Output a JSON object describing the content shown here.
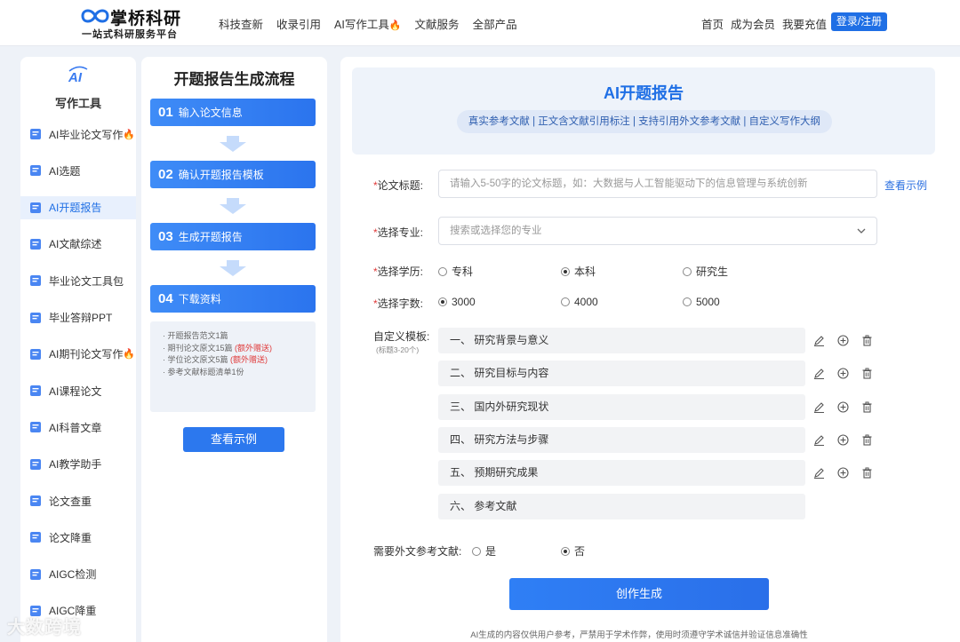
{
  "header": {
    "logo_title": "掌桥科研",
    "logo_subtitle": "一站式科研服务平台",
    "nav": [
      "科技查新",
      "收录引用",
      "AI写作工具",
      "文献服务",
      "全部产品"
    ],
    "right_nav": [
      "首页",
      "成为会员",
      "我要充值"
    ],
    "login_label": "登录/注册"
  },
  "sidebar": {
    "badge": "AI",
    "title": "写作工具",
    "items": [
      {
        "label": "AI毕业论文写作",
        "hot": true,
        "icon": "thesis-icon"
      },
      {
        "label": "AI选题",
        "hot": false,
        "icon": "topic-icon"
      },
      {
        "label": "AI开题报告",
        "hot": false,
        "icon": "report-icon",
        "active": true
      },
      {
        "label": "AI文献综述",
        "hot": false,
        "icon": "review-icon"
      },
      {
        "label": "毕业论文工具包",
        "hot": false,
        "icon": "toolkit-icon"
      },
      {
        "label": "毕业答辩PPT",
        "hot": false,
        "icon": "ppt-icon"
      },
      {
        "label": "AI期刊论文写作",
        "hot": true,
        "icon": "journal-icon"
      },
      {
        "label": "AI课程论文",
        "hot": false,
        "icon": "course-icon"
      },
      {
        "label": "AI科普文章",
        "hot": false,
        "icon": "popsci-icon"
      },
      {
        "label": "AI教学助手",
        "hot": false,
        "icon": "teaching-icon"
      },
      {
        "label": "论文查重",
        "hot": false,
        "icon": "check-icon"
      },
      {
        "label": "论文降重",
        "hot": false,
        "icon": "reduce-icon"
      },
      {
        "label": "AIGC检测",
        "hot": false,
        "icon": "aigc-detect-icon"
      },
      {
        "label": "AIGC降重",
        "hot": false,
        "icon": "aigc-reduce-icon"
      }
    ]
  },
  "process": {
    "title": "开题报告生成流程",
    "steps": [
      {
        "num": "01",
        "label": "输入论文信息"
      },
      {
        "num": "02",
        "label": "确认开题报告模板"
      },
      {
        "num": "03",
        "label": "生成开题报告"
      },
      {
        "num": "04",
        "label": "下载资料"
      }
    ],
    "downloads": [
      {
        "text": "· 开题报告范文1篇",
        "extra": ""
      },
      {
        "text": "· 期刊论文原文15篇",
        "extra": "(额外赠送)"
      },
      {
        "text": "· 学位论文原文5篇",
        "extra": "(额外赠送)"
      },
      {
        "text": "· 参考文献标题清单1份",
        "extra": ""
      }
    ],
    "sample_button": "查看示例"
  },
  "main": {
    "banner_title": "AI开题报告",
    "banner_tags": "真实参考文献 | 正文含文献引用标注 | 支持引用外文参考文献 | 自定义写作大纲",
    "title_label": "论文标题:",
    "title_placeholder": "请输入5-50字的论文标题，如：大数据与人工智能驱动下的信息管理与系统创新",
    "view_example": "查看示例",
    "major_label": "选择专业:",
    "major_placeholder": "搜索或选择您的专业",
    "degree_label": "选择学历:",
    "degree_options": [
      {
        "label": "专科",
        "selected": false
      },
      {
        "label": "本科",
        "selected": true
      },
      {
        "label": "研究生",
        "selected": false
      }
    ],
    "words_label": "选择字数:",
    "words_options": [
      {
        "label": "3000",
        "selected": true
      },
      {
        "label": "4000",
        "selected": false
      },
      {
        "label": "5000",
        "selected": false
      }
    ],
    "template_label": "自定义模板:",
    "template_sub": "(标题3-20个)",
    "template_rows": [
      "一、 研究背景与意义",
      "二、 研究目标与内容",
      "三、 国内外研究现状",
      "四、 研究方法与步骤",
      "五、 预期研究成果",
      "六、 参考文献"
    ],
    "foreign_label": "需要外文参考文献:",
    "foreign_options": [
      {
        "label": "是",
        "selected": false
      },
      {
        "label": "否",
        "selected": true
      }
    ],
    "generate_button": "创作生成",
    "footnote": "AI生成的内容仅供用户参考，严禁用于学术作弊，使用时须遵守学术诚信并验证信息准确性"
  },
  "watermark": "大数跨境",
  "colors": {
    "accent": "#1f6fe5",
    "hot": "#ff5a1f",
    "required": "#e03a3a"
  }
}
